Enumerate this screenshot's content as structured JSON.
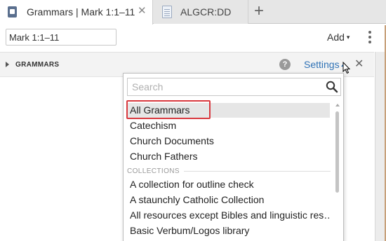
{
  "tabs": [
    {
      "title": "Grammars | Mark 1:1–11",
      "icon": "book-icon",
      "close": "✕"
    },
    {
      "title": "ALGCR:DD",
      "icon": "document-icon"
    }
  ],
  "new_tab_label": "+",
  "address": {
    "reference_value": "Mark 1:1–11"
  },
  "toolbar": {
    "add_label": "Add",
    "add_caret": "▾"
  },
  "section": {
    "title": "GRAMMARS",
    "help_label": "?",
    "settings_label": "Settings",
    "close": "✕"
  },
  "dropdown": {
    "search_placeholder": "Search",
    "items": [
      {
        "label": "All Grammars",
        "selected": true
      },
      {
        "label": "Catechism"
      },
      {
        "label": "Church Documents"
      },
      {
        "label": "Church Fathers"
      }
    ],
    "collections_header": "COLLECTIONS",
    "collections": [
      {
        "label": "A collection for outline check"
      },
      {
        "label": "A staunchly Catholic Collection"
      },
      {
        "label": "All resources except Bibles and linguistic res…"
      },
      {
        "label": "Basic Verbum/Logos library"
      }
    ]
  },
  "colors": {
    "accent_link": "#2f72b6",
    "highlight_border": "#d9393f",
    "selected_row": "#e6e6e6"
  }
}
